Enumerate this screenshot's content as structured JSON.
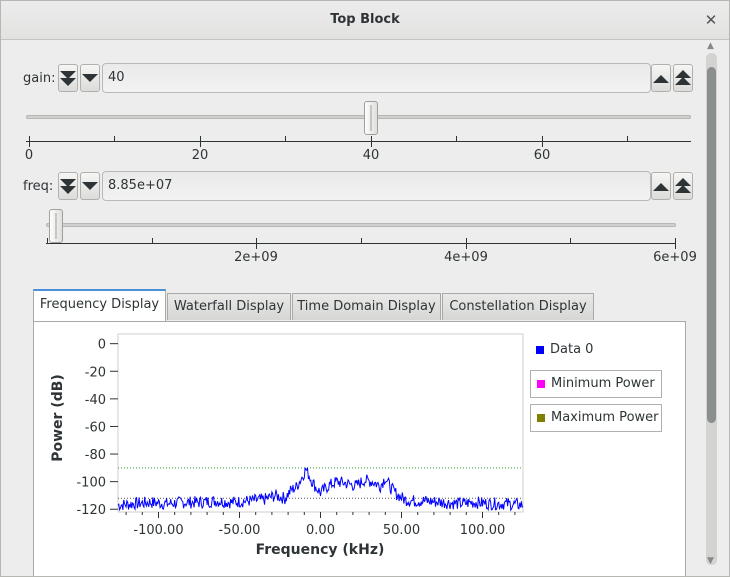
{
  "window": {
    "title": "Top Block"
  },
  "gain": {
    "label": "gain:",
    "value": "40",
    "slider_value": 40,
    "slider_min": 0,
    "slider_max": 73,
    "ticks": [
      "0",
      "20",
      "40",
      "60"
    ]
  },
  "freq": {
    "label": "freq:",
    "value": "8.85e+07",
    "slider_value": 88500000,
    "slider_min": 0,
    "slider_max": 6000000000,
    "ticks": [
      "2e+09",
      "4e+09",
      "6e+09"
    ]
  },
  "tabs": [
    "Frequency Display",
    "Waterfall Display",
    "Time Domain Display",
    "Constellation Display"
  ],
  "active_tab": "Frequency Display",
  "chart_data": {
    "type": "line",
    "title": "",
    "xlabel": "Frequency (kHz)",
    "ylabel": "Power (dB)",
    "xlim": [
      -125,
      125
    ],
    "ylim": [
      -122,
      7
    ],
    "x_ticks": [
      "-100.00",
      "-50.00",
      "0.00",
      "50.00",
      "100.00"
    ],
    "y_ticks": [
      "0",
      "-20",
      "-40",
      "-60",
      "-80",
      "-100",
      "-120"
    ],
    "series": [
      {
        "name": "Data 0",
        "color": "#0000ff",
        "x": [
          -125,
          -115,
          -105,
          -95,
          -85,
          -75,
          -65,
          -55,
          -45,
          -35,
          -28,
          -22,
          -18,
          -15,
          -12,
          -9,
          -6,
          -3,
          0,
          5,
          10,
          15,
          18,
          22,
          27,
          32,
          37,
          40,
          43,
          47,
          52,
          58,
          65,
          75,
          85,
          95,
          105,
          115,
          125
        ],
        "y": [
          -117,
          -116,
          -115,
          -116,
          -115,
          -115,
          -114,
          -115,
          -114,
          -113,
          -110,
          -112,
          -106,
          -104,
          -98,
          -91,
          -98,
          -104,
          -108,
          -103,
          -100,
          -101,
          -102,
          -103,
          -99,
          -100,
          -103,
          -97,
          -104,
          -109,
          -113,
          -114,
          -114,
          -115,
          -116,
          -115,
          -116,
          -116,
          -117
        ]
      }
    ],
    "min_power": {
      "name": "Minimum Power",
      "color": "#ff00ff",
      "value": -112
    },
    "max_power": {
      "name": "Maximum Power",
      "color": "#7f7f00",
      "value": -90
    },
    "grid": false,
    "legend": "right"
  }
}
